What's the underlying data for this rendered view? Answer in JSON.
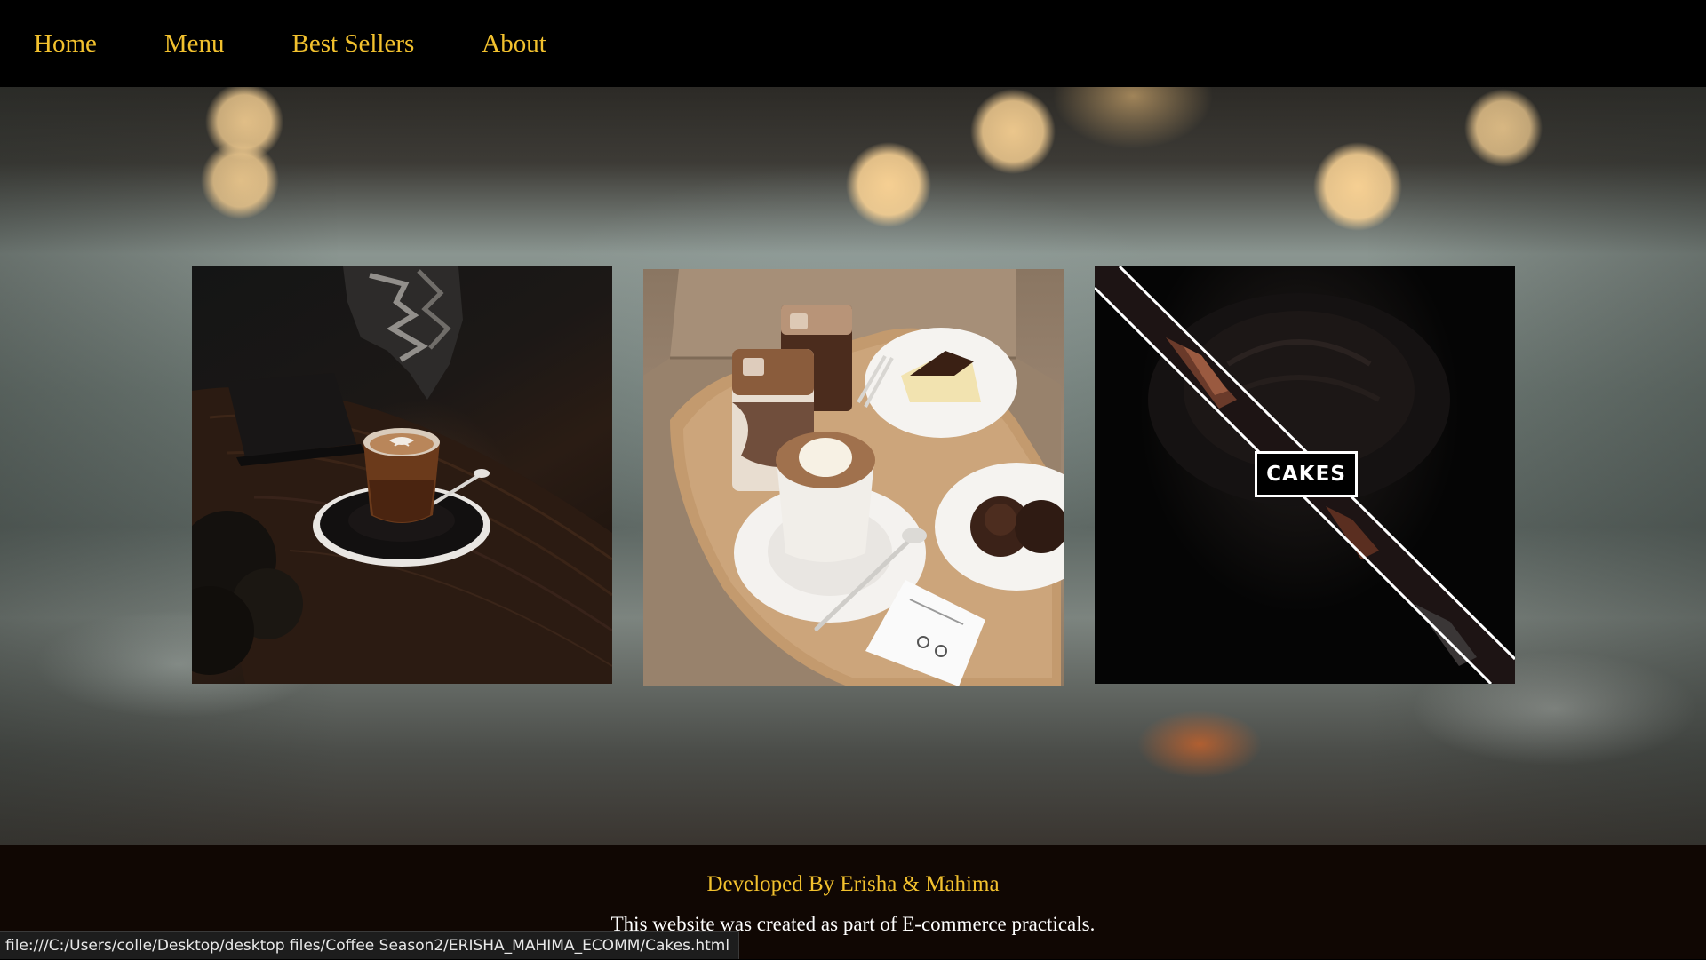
{
  "nav": {
    "items": [
      {
        "label": "Home"
      },
      {
        "label": "Menu"
      },
      {
        "label": "Best Sellers"
      },
      {
        "label": "About"
      }
    ],
    "link_color": "#f2c12e"
  },
  "gallery": {
    "cards": [
      {
        "name": "espresso-photo"
      },
      {
        "name": "iced-coffee-and-pastries-photo"
      },
      {
        "name": "cakes-photo",
        "label": "CAKES"
      }
    ]
  },
  "footer": {
    "credit": "Developed By Erisha & Mahima",
    "note": "This website was created as part of E-commerce practicals."
  },
  "status_bar": {
    "url": "file:///C:/Users/colle/Desktop/desktop files/Coffee Season2/ERISHA_MAHIMA_ECOMM/Cakes.html"
  }
}
